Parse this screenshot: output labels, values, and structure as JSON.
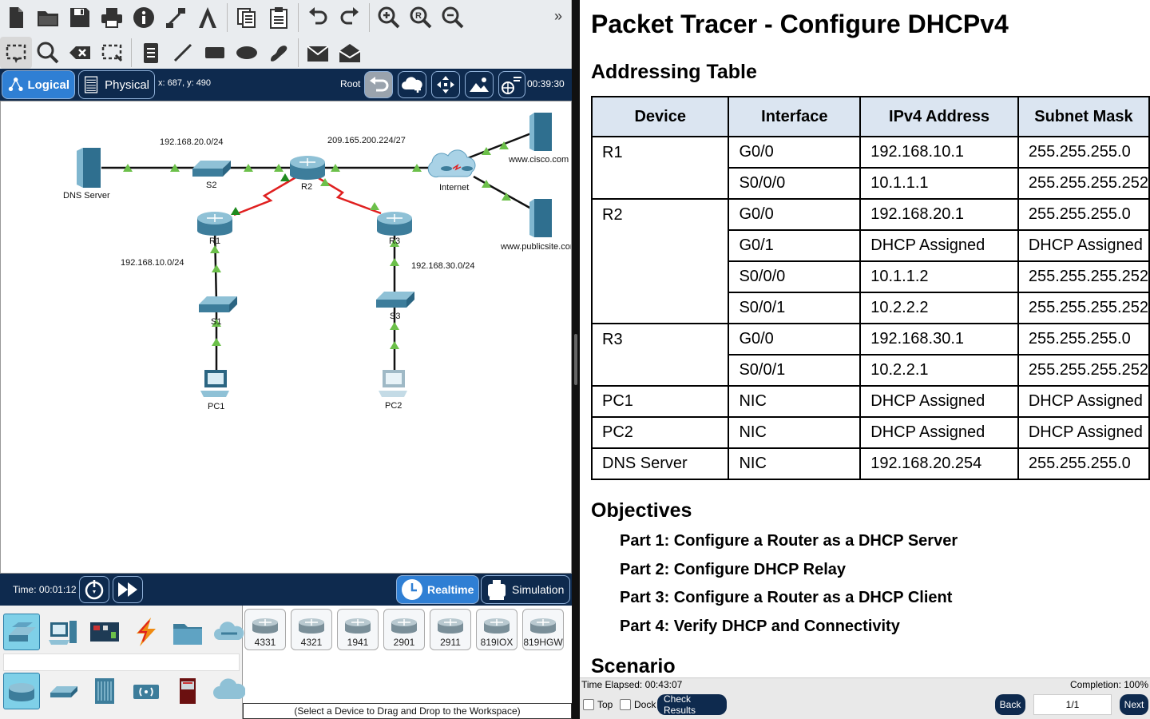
{
  "toolbar": {
    "row1_icons": [
      "new-file-icon",
      "open-folder-icon",
      "save-icon",
      "print-icon",
      "info-icon",
      "network-wizard-icon",
      "activity-wizard-icon",
      "copy-icon",
      "paste-icon",
      "undo-icon",
      "redo-icon",
      "zoom-in-icon",
      "zoom-reset-icon",
      "zoom-out-icon"
    ],
    "row2_icons": [
      "select-icon",
      "inspect-icon",
      "delete-icon",
      "resize-icon",
      "note-icon",
      "draw-line-icon",
      "draw-rectangle-icon",
      "draw-ellipse-icon",
      "freeform-icon",
      "add-simple-pdu-icon",
      "add-complex-pdu-icon"
    ],
    "more": "»"
  },
  "modebar": {
    "logical": "Logical",
    "physical": "Physical",
    "coords": "x: 687, y: 490",
    "root": "Root",
    "clock": "00:39:30"
  },
  "topology": {
    "devices": {
      "dns": "DNS Server",
      "s2": "S2",
      "r2": "R2",
      "r1": "R1",
      "r3": "R3",
      "s1": "S1",
      "s3": "S3",
      "pc1": "PC1",
      "pc2": "PC2",
      "internet": "Internet",
      "cisco": "www.cisco.com",
      "publicsite": "www.publicsite.com"
    },
    "networks": {
      "n20": "192.168.20.0/24",
      "n209": "209.165.200.224/27",
      "n10": "192.168.10.0/24",
      "n30": "192.168.30.0/24"
    }
  },
  "timebar": {
    "time": "Time: 00:01:12",
    "realtime": "Realtime",
    "simulation": "Simulation"
  },
  "devices_panel": {
    "categories_top": [
      "end-devices-category",
      "network-devices-category",
      "components-category",
      "connections-category",
      "misc-category",
      "multiuser-category"
    ],
    "categories_bottom": [
      "routers-category",
      "switches-category",
      "hubs-category",
      "wireless-category",
      "security-category",
      "wan-emulation-category"
    ],
    "models": [
      "4331",
      "4321",
      "1941",
      "2901",
      "2911",
      "819IOX",
      "819HGW"
    ],
    "hint": "(Select a Device to Drag and Drop to the Workspace)"
  },
  "doc": {
    "title": "Packet Tracer - Configure DHCPv4",
    "addressing_heading": "Addressing Table",
    "table_headers": [
      "Device",
      "Interface",
      "IPv4 Address",
      "Subnet Mask"
    ],
    "rows": [
      {
        "device": "R1",
        "interfaces": [
          [
            "G0/0",
            "192.168.10.1",
            "255.255.255.0"
          ],
          [
            "S0/0/0",
            "10.1.1.1",
            "255.255.255.252"
          ]
        ]
      },
      {
        "device": "R2",
        "interfaces": [
          [
            "G0/0",
            "192.168.20.1",
            "255.255.255.0"
          ],
          [
            "G0/1",
            "DHCP Assigned",
            "DHCP Assigned"
          ],
          [
            "S0/0/0",
            "10.1.1.2",
            "255.255.255.252"
          ],
          [
            "S0/0/1",
            "10.2.2.2",
            "255.255.255.252"
          ]
        ]
      },
      {
        "device": "R3",
        "interfaces": [
          [
            "G0/0",
            "192.168.30.1",
            "255.255.255.0"
          ],
          [
            "S0/0/1",
            "10.2.2.1",
            "255.255.255.252"
          ]
        ]
      },
      {
        "device": "PC1",
        "interfaces": [
          [
            "NIC",
            "DHCP Assigned",
            "DHCP Assigned"
          ]
        ]
      },
      {
        "device": "PC2",
        "interfaces": [
          [
            "NIC",
            "DHCP Assigned",
            "DHCP Assigned"
          ]
        ]
      },
      {
        "device": "DNS Server",
        "interfaces": [
          [
            "NIC",
            "192.168.20.254",
            "255.255.255.0"
          ]
        ]
      }
    ],
    "objectives_heading": "Objectives",
    "objectives": [
      "Part 1: Configure a Router as a DHCP Server",
      "Part 2: Configure DHCP Relay",
      "Part 3: Configure a Router as a DHCP Client",
      "Part 4: Verify DHCP and Connectivity"
    ],
    "scenario_heading": "Scenario"
  },
  "taskbar": {
    "elapsed": "Time Elapsed: 00:43:07",
    "completion": "Completion: 100%",
    "top": "Top",
    "dock": "Dock",
    "check": "Check Results",
    "back": "Back",
    "page": "1/1",
    "next": "Next"
  },
  "colors": {
    "navy": "#0e2a4e",
    "accent_blue": "#2f7fd4",
    "link_green": "#6cc04a",
    "serial_red": "#e02020",
    "header_fill": "#dbe5f1"
  }
}
